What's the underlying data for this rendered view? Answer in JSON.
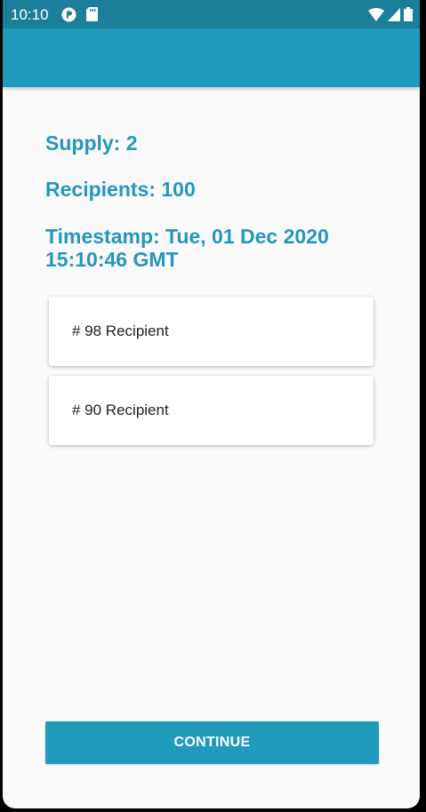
{
  "status_bar": {
    "time": "10:10",
    "left_icons": [
      "app-notification-icon",
      "sd-card-icon"
    ],
    "right_icons": [
      "wifi-icon",
      "cell-signal-icon",
      "battery-icon"
    ]
  },
  "content": {
    "supply": "Supply: 2",
    "recipients": "Recipients: 100",
    "timestamp_line1": "Timestamp: Tue, 01 Dec 2020",
    "timestamp_line2": "15:10:46 GMT"
  },
  "recipient_list": [
    {
      "label": "# 98 Recipient"
    },
    {
      "label": "# 90 Recipient"
    }
  ],
  "actions": {
    "continue_label": "CONTINUE"
  },
  "colors": {
    "status_bar": "#1c7f99",
    "app_bar": "#219bbd",
    "accent_text": "#2596be",
    "background": "#fafafa"
  }
}
